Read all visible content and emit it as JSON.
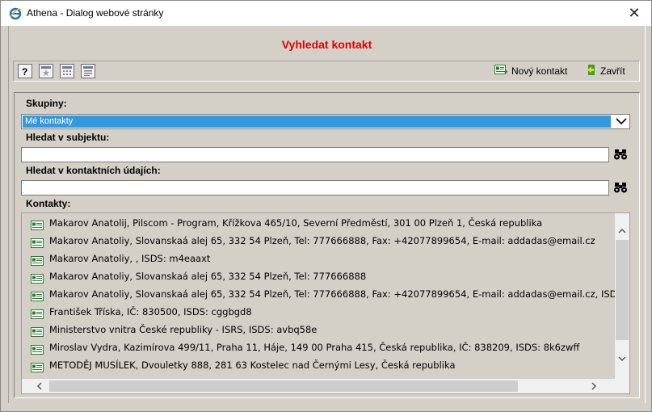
{
  "window": {
    "title": "Athena - Dialog webové stránky",
    "close_glyph": "✕",
    "icon": "ie-icon"
  },
  "dialog": {
    "title": "Vyhledat kontakt",
    "title_color": "#e00000"
  },
  "toolbar": {
    "icons": [
      "help-icon",
      "favorite-icon",
      "calendar-icon",
      "window-icon"
    ],
    "new_contact_label": "Nový kontakt",
    "close_label": "Zavřít"
  },
  "form": {
    "groups_label": "Skupiny:",
    "groups_selected": "Mé kontakty",
    "subject_label": "Hledat v subjektu:",
    "subject_value": "",
    "contact_data_label": "Hledat v kontaktních údajích:",
    "contact_data_value": "",
    "contacts_label": "Kontakty:"
  },
  "contacts": [
    "Makarov Anatolij, Pilscom - Program, Křížkova 465/10, Severní Předměstí, 301 00 Plzeň 1, Česká republika",
    "Makarov Anatoliy, Slovanskaá alej 65, 332 54 Plzeň, Tel: 777666888, Fax: +42077899654, E-mail: addadas@email.cz",
    "Makarov Anatoliy, , ISDS: m4eaaxt",
    "Makarov Anatoliy, Slovanskaá alej 65, 332 54 Plzeň, Tel: 777666888",
    "Makarov Anatoliy, Slovanskaá alej 65, 332 54 Plzeň, Tel: 777666888, Fax: +42077899654, E-mail: addadas@email.cz, ISDS:",
    "František Tříska, IČ: 830500, ISDS: cggbgd8",
    "Ministerstvo vnitra České republiky - ISRS, ISDS: avbq58e",
    "Miroslav Vydra, Kazimírova 499/11, Praha 11, Háje, 149 00 Praha 415, Česká republika, IČ: 838209, ISDS: 8k6zwff",
    "METODĚJ MUSÍLEK, Dvouletky 888, 281 63 Kostelec nad Černými Lesy, Česká republika"
  ],
  "colors": {
    "selection": "#3399dd",
    "panel_bg": "#d4d0c8"
  }
}
